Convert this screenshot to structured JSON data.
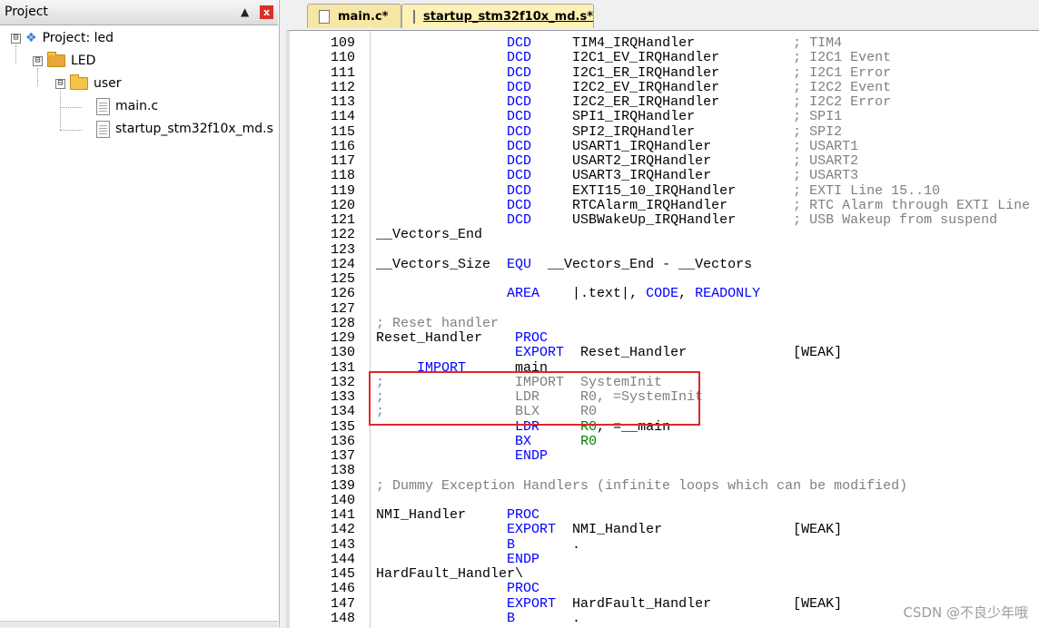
{
  "project_pane": {
    "title": "Project",
    "pin_icon": "pin-icon",
    "close_label": "x",
    "tree": [
      {
        "label": "Project: led",
        "toggle": "⊟",
        "icon": "project-icon"
      },
      {
        "label": "LED",
        "toggle": "⊟",
        "icon": "target-folder-icon"
      },
      {
        "label": "user",
        "toggle": "⊟",
        "icon": "folder-icon"
      },
      {
        "label": "main.c",
        "icon": "file-icon"
      },
      {
        "label": "startup_stm32f10x_md.s",
        "icon": "file-icon"
      }
    ]
  },
  "tabs": [
    {
      "label": "main.c*",
      "active": false
    },
    {
      "label": "startup_stm32f10x_md.s*",
      "active": true
    }
  ],
  "editor": {
    "lines": [
      {
        "num": "109",
        "code": [
          [
            "",
            "                "
          ],
          [
            "kw",
            "DCD"
          ],
          [
            "",
            "     TIM4_IRQHandler            "
          ],
          [
            "cm",
            "; TIM4"
          ]
        ]
      },
      {
        "num": "110",
        "code": [
          [
            "",
            "                "
          ],
          [
            "kw",
            "DCD"
          ],
          [
            "",
            "     I2C1_EV_IRQHandler         "
          ],
          [
            "cm",
            "; I2C1 Event"
          ]
        ]
      },
      {
        "num": "111",
        "code": [
          [
            "",
            "                "
          ],
          [
            "kw",
            "DCD"
          ],
          [
            "",
            "     I2C1_ER_IRQHandler         "
          ],
          [
            "cm",
            "; I2C1 Error"
          ]
        ]
      },
      {
        "num": "112",
        "code": [
          [
            "",
            "                "
          ],
          [
            "kw",
            "DCD"
          ],
          [
            "",
            "     I2C2_EV_IRQHandler         "
          ],
          [
            "cm",
            "; I2C2 Event"
          ]
        ]
      },
      {
        "num": "113",
        "code": [
          [
            "",
            "                "
          ],
          [
            "kw",
            "DCD"
          ],
          [
            "",
            "     I2C2_ER_IRQHandler         "
          ],
          [
            "cm",
            "; I2C2 Error"
          ]
        ]
      },
      {
        "num": "114",
        "code": [
          [
            "",
            "                "
          ],
          [
            "kw",
            "DCD"
          ],
          [
            "",
            "     SPI1_IRQHandler            "
          ],
          [
            "cm",
            "; SPI1"
          ]
        ]
      },
      {
        "num": "115",
        "code": [
          [
            "",
            "                "
          ],
          [
            "kw",
            "DCD"
          ],
          [
            "",
            "     SPI2_IRQHandler            "
          ],
          [
            "cm",
            "; SPI2"
          ]
        ]
      },
      {
        "num": "116",
        "code": [
          [
            "",
            "                "
          ],
          [
            "kw",
            "DCD"
          ],
          [
            "",
            "     USART1_IRQHandler          "
          ],
          [
            "cm",
            "; USART1"
          ]
        ]
      },
      {
        "num": "117",
        "code": [
          [
            "",
            "                "
          ],
          [
            "kw",
            "DCD"
          ],
          [
            "",
            "     USART2_IRQHandler          "
          ],
          [
            "cm",
            "; USART2"
          ]
        ]
      },
      {
        "num": "118",
        "code": [
          [
            "",
            "                "
          ],
          [
            "kw",
            "DCD"
          ],
          [
            "",
            "     USART3_IRQHandler          "
          ],
          [
            "cm",
            "; USART3"
          ]
        ]
      },
      {
        "num": "119",
        "code": [
          [
            "",
            "                "
          ],
          [
            "kw",
            "DCD"
          ],
          [
            "",
            "     EXTI15_10_IRQHandler       "
          ],
          [
            "cm",
            "; EXTI Line 15..10"
          ]
        ]
      },
      {
        "num": "120",
        "code": [
          [
            "",
            "                "
          ],
          [
            "kw",
            "DCD"
          ],
          [
            "",
            "     RTCAlarm_IRQHandler        "
          ],
          [
            "cm",
            "; RTC Alarm through EXTI Line"
          ]
        ]
      },
      {
        "num": "121",
        "code": [
          [
            "",
            "                "
          ],
          [
            "kw",
            "DCD"
          ],
          [
            "",
            "     USBWakeUp_IRQHandler       "
          ],
          [
            "cm",
            "; USB Wakeup from suspend"
          ]
        ]
      },
      {
        "num": "122",
        "code": [
          [
            "",
            "__Vectors_End"
          ]
        ]
      },
      {
        "num": "123",
        "code": []
      },
      {
        "num": "124",
        "code": [
          [
            "",
            "__Vectors_Size  "
          ],
          [
            "kw",
            "EQU"
          ],
          [
            "",
            "  __Vectors_End - __Vectors"
          ]
        ]
      },
      {
        "num": "125",
        "code": []
      },
      {
        "num": "126",
        "code": [
          [
            "",
            "                "
          ],
          [
            "kw",
            "AREA"
          ],
          [
            "",
            "    |.text|, "
          ],
          [
            "kw",
            "CODE"
          ],
          [
            "",
            ", "
          ],
          [
            "kw",
            "READONLY"
          ]
        ]
      },
      {
        "num": "127",
        "code": []
      },
      {
        "num": "128",
        "code": [
          [
            "cm",
            "; Reset handler"
          ]
        ]
      },
      {
        "num": "129",
        "code": [
          [
            "",
            "Reset_Handler    "
          ],
          [
            "kw",
            "PROC"
          ]
        ]
      },
      {
        "num": "130",
        "code": [
          [
            "",
            "                 "
          ],
          [
            "kw",
            "EXPORT"
          ],
          [
            "",
            "  Reset_Handler             [WEAK]"
          ]
        ]
      },
      {
        "num": "131",
        "code": [
          [
            "",
            "     "
          ],
          [
            "kw",
            "IMPORT"
          ],
          [
            "",
            "    __main"
          ]
        ]
      },
      {
        "num": "132",
        "code": [
          [
            "cm",
            ";                IMPORT  SystemInit"
          ]
        ]
      },
      {
        "num": "133",
        "code": [
          [
            "cm",
            ";                LDR     R0, =SystemInit"
          ]
        ]
      },
      {
        "num": "134",
        "code": [
          [
            "cm",
            ";                BLX     R0"
          ]
        ]
      },
      {
        "num": "135",
        "code": [
          [
            "",
            "                 "
          ],
          [
            "kw",
            "LDR"
          ],
          [
            "",
            "     "
          ],
          [
            "reg",
            "R0"
          ],
          [
            "",
            ", =__main"
          ]
        ]
      },
      {
        "num": "136",
        "code": [
          [
            "",
            "                 "
          ],
          [
            "kw",
            "BX"
          ],
          [
            "",
            "      "
          ],
          [
            "reg",
            "R0"
          ]
        ]
      },
      {
        "num": "137",
        "code": [
          [
            "",
            "                 "
          ],
          [
            "kw",
            "ENDP"
          ]
        ]
      },
      {
        "num": "138",
        "code": []
      },
      {
        "num": "139",
        "code": [
          [
            "cm",
            "; Dummy Exception Handlers (infinite loops which can be modified)"
          ]
        ]
      },
      {
        "num": "140",
        "code": []
      },
      {
        "num": "141",
        "code": [
          [
            "",
            "NMI_Handler     "
          ],
          [
            "kw",
            "PROC"
          ]
        ]
      },
      {
        "num": "142",
        "code": [
          [
            "",
            "                "
          ],
          [
            "kw",
            "EXPORT"
          ],
          [
            "",
            "  NMI_Handler                [WEAK]"
          ]
        ]
      },
      {
        "num": "143",
        "code": [
          [
            "",
            "                "
          ],
          [
            "kw",
            "B"
          ],
          [
            "",
            "       ."
          ]
        ]
      },
      {
        "num": "144",
        "code": [
          [
            "",
            "                "
          ],
          [
            "kw",
            "ENDP"
          ]
        ]
      },
      {
        "num": "145",
        "code": [
          [
            "",
            "HardFault_Handler\\"
          ]
        ]
      },
      {
        "num": "146",
        "code": [
          [
            "",
            "                "
          ],
          [
            "kw",
            "PROC"
          ]
        ]
      },
      {
        "num": "147",
        "code": [
          [
            "",
            "                "
          ],
          [
            "kw",
            "EXPORT"
          ],
          [
            "",
            "  HardFault_Handler          [WEAK]"
          ]
        ]
      },
      {
        "num": "148",
        "code": [
          [
            "",
            "                "
          ],
          [
            "kw",
            "B"
          ],
          [
            "",
            "       ."
          ]
        ]
      }
    ]
  },
  "watermark": "CSDN @不良少年哦",
  "colors": {
    "keyword": "#0000ff",
    "comment": "#7f7f7f",
    "register": "#008000",
    "highlight_box": "#e0262c"
  }
}
